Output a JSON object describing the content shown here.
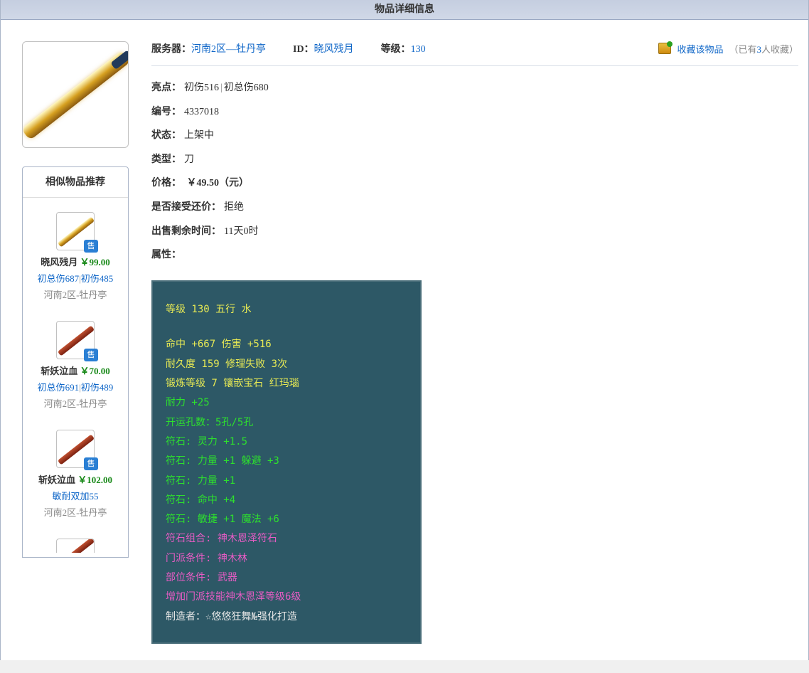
{
  "header": {
    "title": "物品详细信息"
  },
  "item_image": {
    "alt": "刀-武器图"
  },
  "rec": {
    "title": "相似物品推荐",
    "sale_tag": "售",
    "items": [
      {
        "thumb_style": "gold",
        "name": "晓风残月",
        "price": "￥99.00",
        "hl1": "初总伤687",
        "hl2": "初伤485",
        "server": "河南2区-牡丹亭"
      },
      {
        "thumb_style": "red",
        "name": "斩妖泣血",
        "price": "￥70.00",
        "hl1": "初总伤691",
        "hl2": "初伤489",
        "server": "河南2区-牡丹亭"
      },
      {
        "thumb_style": "red",
        "name": "斩妖泣血",
        "price": "￥102.00",
        "hl1": "敏耐双加55",
        "hl2": "",
        "server": "河南2区-牡丹亭"
      }
    ]
  },
  "top": {
    "server_label": "服务器：",
    "server_value": "河南2区—牡丹亭",
    "id_label": "ID：",
    "id_value": "晓风残月",
    "level_label": "等级：",
    "level_value": "130"
  },
  "fav": {
    "link_text": "收藏该物品",
    "count_prefix": "（已有",
    "count_n": "3",
    "count_suffix": "人收藏）"
  },
  "info": {
    "hl_label": "亮点：",
    "hl1": "初伤516",
    "hl2": "初总伤680",
    "num_label": "编号：",
    "num_value": "4337018",
    "status_label": "状态：",
    "status_value": "上架中",
    "type_label": "类型：",
    "type_value": "刀",
    "price_label": "价格：",
    "price_value": " ￥49.50（元）",
    "bargain_label": "是否接受还价：",
    "bargain_value": "拒绝",
    "remain_label": "出售剩余时间：",
    "remain_value": "11天0时",
    "attr_label": "属性："
  },
  "stats": {
    "l0": "等级 130 五行 水",
    "l1": "命中 +667 伤害 +516",
    "l2": "耐久度 159 修理失败 3次",
    "l3": "锻炼等级 7 镶嵌宝石 红玛瑙",
    "l4": "耐力 +25",
    "l5": "开运孔数：5孔/5孔",
    "l6": "符石: 灵力 +1.5",
    "l7": "符石: 力量 +1 躲避 +3",
    "l8": "符石: 力量 +1",
    "l9": "符石: 命中 +4",
    "l10": "符石: 敏捷 +1 魔法 +6",
    "l11": "符石组合: 神木恩泽符石",
    "l12": "门派条件: 神木林",
    "l13": "部位条件: 武器",
    "l14": "增加门派技能神木恩泽等级6级",
    "l15": "制造者：☆悠悠狂舞№强化打造"
  }
}
